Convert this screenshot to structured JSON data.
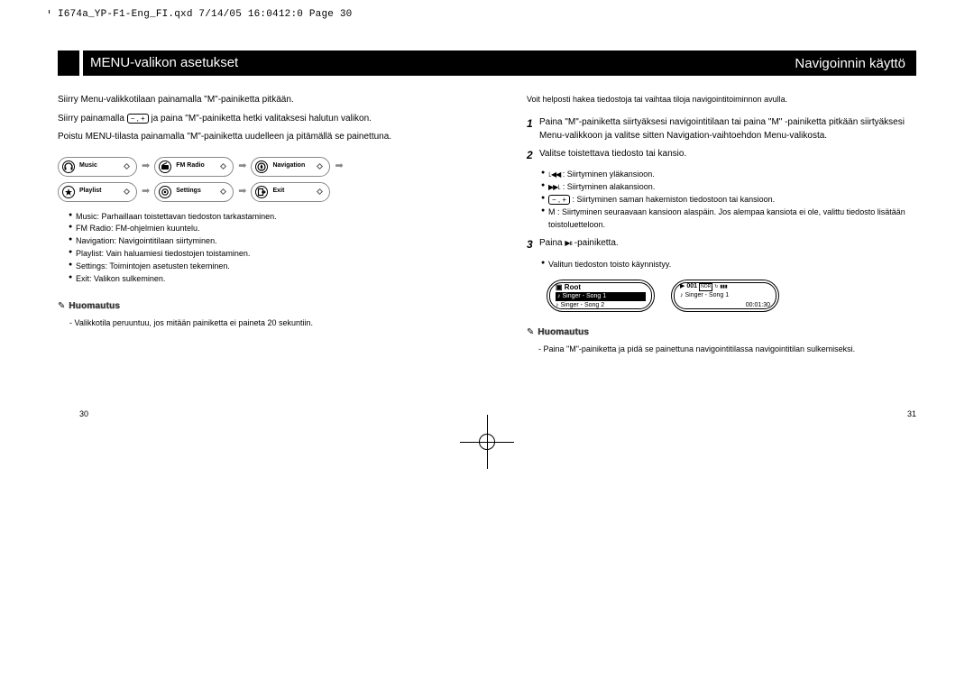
{
  "meta": {
    "line": "I674a_YP-F1-Eng_FI.qxd  7/14/05 16:0412:0  Page 30"
  },
  "bar": {
    "left": "MENU-valikon asetukset",
    "right": "Navigoinnin käyttö"
  },
  "left": {
    "p1": "Siirry Menu-valikkotilaan painamalla \"M\"-painiketta pitkään.",
    "p2a": "Siirry painamalla ",
    "p2b": " ja paina \"M\"-painiketta hetki valitaksesi halutun valikon.",
    "p3": "Poistu MENU-tilasta painamalla \"M\"-painiketta uudelleen ja pitämällä se painettuna.",
    "pills": [
      "Music",
      "FM Radio",
      "Navigation",
      "Playlist",
      "Settings",
      "Exit"
    ],
    "bullets": [
      "Music: Parhaillaan toistettavan tiedoston tarkastaminen.",
      "FM Radio: FM-ohjelmien kuuntelu.",
      "Navigation: Navigointitilaan siirtyminen.",
      "Playlist: Vain haluamiesi tiedostojen toistaminen.",
      "Settings: Toimintojen asetusten tekeminen.",
      "Exit: Valikon sulkeminen."
    ],
    "note_title": "Huomautus",
    "note_text": "- Valikkotila peruuntuu, jos mitään painiketta ei paineta 20 sekuntiin.",
    "pagenum": "30"
  },
  "right": {
    "intro": "Voit helposti hakea tiedostoja tai vaihtaa tiloja navigointitoiminnon avulla.",
    "s1": "Paina \"M\"-painiketta siirtyäksesi navigointitilaan tai paina \"M\" -painiketta pitkään siirtyäksesi Menu-valikkoon ja valitse sitten Navigation-vaihtoehdon Menu-valikosta.",
    "s2": "Valitse toistettava tiedosto tai kansio.",
    "s2_items": [
      ": Siirtyminen yläkansioon.",
      ": Siirtyminen alakansioon.",
      ": Siirtyminen saman hakemiston tiedostoon tai kansioon.",
      "M : Siirtyminen seuraavaan kansioon alaspäin. Jos alempaa kansiota ei ole, valittu tiedosto lisätään toistoluetteloon."
    ],
    "s2_glyphs": [
      "꜖◀◀",
      "▶▶꜖",
      "− , +",
      ""
    ],
    "s3a": "Paina ",
    "s3b": " -painiketta.",
    "s3_item": "Valitun tiedoston toisto käynnistyy.",
    "device1": {
      "title": "Root",
      "row1": "Singer - Song 1",
      "row2": "Singer - Song 2"
    },
    "device2": {
      "track": "001",
      "song": "Singer - Song 1",
      "time": "00:01:30"
    },
    "note_title": "Huomautus",
    "note_text": "- Paina \"M\"-painiketta ja pidä se painettuna navigointitilassa navigointitilan sulkemiseksi.",
    "pagenum": "31"
  }
}
